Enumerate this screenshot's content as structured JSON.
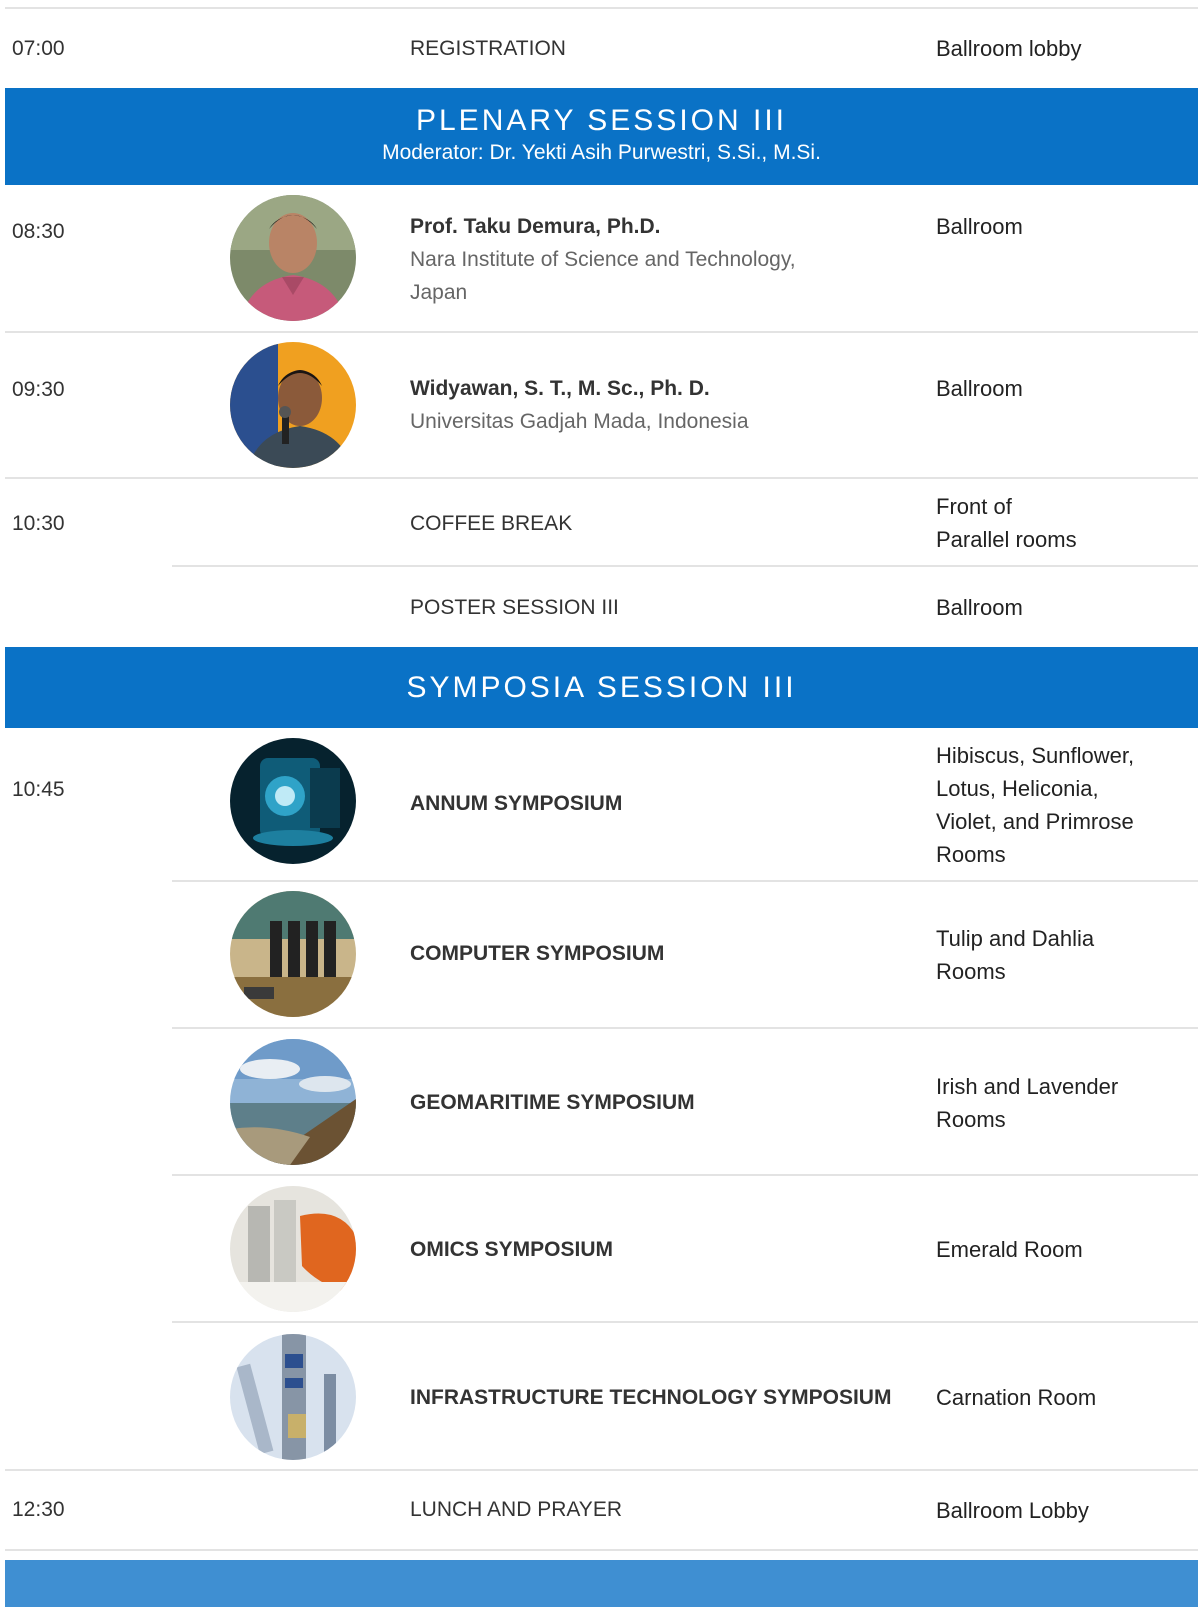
{
  "colors": {
    "band": "#0a72c6",
    "divider": "#e3e3e3"
  },
  "registration": {
    "time": "07:00",
    "title": "REGISTRATION",
    "location": "Ballroom lobby"
  },
  "plenary": {
    "title": "PLENARY SESSION III",
    "moderator": "Moderator: Dr. Yekti Asih Purwestri, S.Si., M.Si.",
    "talks": [
      {
        "time": "08:30",
        "speaker": "Prof. Taku Demura, Ph.D.",
        "affiliation_line1": "Nara Institute of Science and Technology,",
        "affiliation_line2": "Japan",
        "location": "Ballroom"
      },
      {
        "time": "09:30",
        "speaker": "Widyawan, S. T., M. Sc., Ph. D.",
        "affiliation_line1": "Universitas Gadjah Mada, Indonesia",
        "location": "Ballroom"
      }
    ]
  },
  "coffee": {
    "time": "10:30",
    "title": "COFFEE BREAK",
    "location_line1": "Front of",
    "location_line2": "Parallel rooms"
  },
  "poster": {
    "title": "POSTER SESSION III",
    "location": "Ballroom"
  },
  "symposia": {
    "title": "SYMPOSIA SESSION III",
    "time": "10:45",
    "items": [
      {
        "name": "ANNUM SYMPOSIUM",
        "location_lines": [
          "Hibiscus, Sunflower,",
          "Lotus, Heliconia,",
          "Violet, and Primrose",
          "Rooms"
        ]
      },
      {
        "name": "COMPUTER SYMPOSIUM",
        "location_lines": [
          "Tulip and Dahlia",
          "Rooms"
        ]
      },
      {
        "name": "GEOMARITIME SYMPOSIUM",
        "location_lines": [
          "Irish and Lavender",
          "Rooms"
        ]
      },
      {
        "name": "OMICS SYMPOSIUM",
        "location_lines": [
          "Emerald Room"
        ]
      },
      {
        "name": "INFRASTRUCTURE TECHNOLOGY SYMPOSIUM",
        "location_lines": [
          "Carnation Room"
        ]
      }
    ]
  },
  "lunch": {
    "time": "12:30",
    "title": "LUNCH AND PRAYER",
    "location": "Ballroom Lobby"
  }
}
